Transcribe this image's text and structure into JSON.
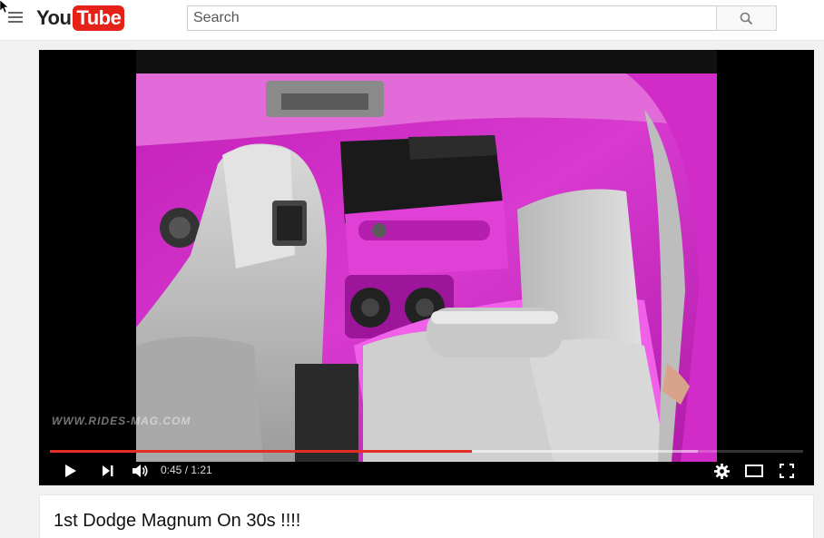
{
  "masthead": {
    "logo_you": "You",
    "logo_tube": "Tube",
    "search_placeholder": "Search",
    "icons": [
      "cursor-icon",
      "menu-icon",
      "search-icon"
    ]
  },
  "player": {
    "watermark": "WWW.RIDES-MAG.COM",
    "current_time": "0:45",
    "duration": "1:21",
    "time_display": "0:45 / 1:21",
    "progress_played_fraction": 0.56,
    "progress_buffered_fraction": 0.86,
    "colors": {
      "progress_played": "#e52d27",
      "background": "#000000"
    },
    "icons": [
      "play-icon",
      "next-icon",
      "volume-icon",
      "settings-icon",
      "theater-mode-icon",
      "fullscreen-icon"
    ]
  },
  "video": {
    "title": "1st Dodge Magnum On 30s !!!!"
  },
  "colors": {
    "brand_red": "#e62117",
    "page_background": "#f1f1f1"
  }
}
